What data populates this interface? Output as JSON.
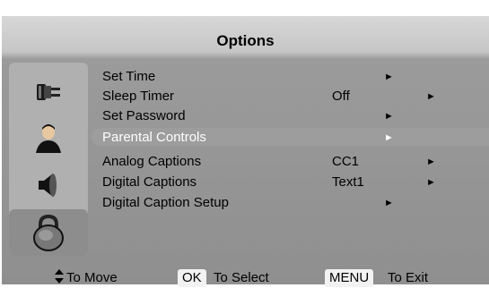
{
  "title": "Options",
  "menu": [
    {
      "label": "Set Time",
      "value": "",
      "arrow": "►"
    },
    {
      "label": "Sleep Timer",
      "value": "Off",
      "arrow": "►"
    },
    {
      "label": "Set Password",
      "value": "",
      "arrow": "►"
    },
    {
      "label": "Parental Controls",
      "value": "",
      "arrow": "►"
    },
    {
      "label": "Analog Captions",
      "value": "CC1",
      "arrow": "►"
    },
    {
      "label": "Digital Captions",
      "value": "Text1",
      "arrow": "►"
    },
    {
      "label": "Digital Caption Setup",
      "value": "",
      "arrow": "►"
    }
  ],
  "footer": {
    "move_text": "To Move",
    "ok_key": "OK",
    "select_text": "To Select",
    "menu_key": "MENU",
    "exit_text": "To Exit"
  },
  "icons": [
    "plug-icon",
    "person-icon",
    "speaker-icon",
    "lock-icon"
  ],
  "colors": {
    "highlight": "#9d9d9d",
    "panel": "#8f8f8f",
    "title_bar": "#d7d7d7"
  }
}
